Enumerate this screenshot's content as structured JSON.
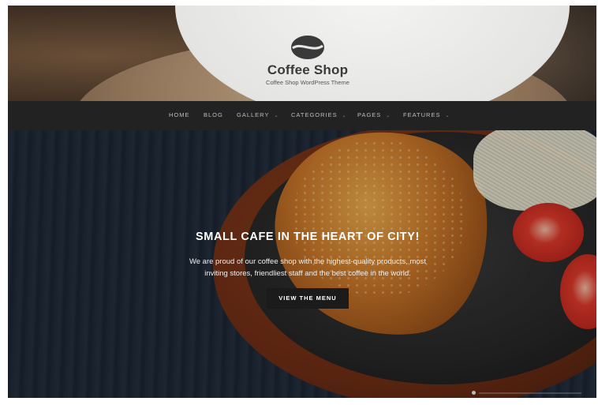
{
  "brand": {
    "title": "Coffee Shop",
    "tagline": "Coffee Shop WordPress Theme",
    "logo_icon": "coffee-bean-icon",
    "logo_color": "#3a3a3a"
  },
  "nav": {
    "background": "#222223",
    "items": [
      {
        "label": "HOME",
        "has_dropdown": false
      },
      {
        "label": "BLOG",
        "has_dropdown": false
      },
      {
        "label": "GALLERY",
        "has_dropdown": true
      },
      {
        "label": "CATEGORIES",
        "has_dropdown": true
      },
      {
        "label": "PAGES",
        "has_dropdown": true
      },
      {
        "label": "FEATURES",
        "has_dropdown": true
      }
    ]
  },
  "hero": {
    "title": "SMALL CAFE IN THE HEART OF CITY!",
    "text_line1": "We are proud of our coffee shop with the highest-quality products, most",
    "text_line2": "inviting stores, friendliest staff and the best coffee in the world.",
    "button_label": "VIEW THE MENU",
    "button_color": "#1b1b1b"
  }
}
